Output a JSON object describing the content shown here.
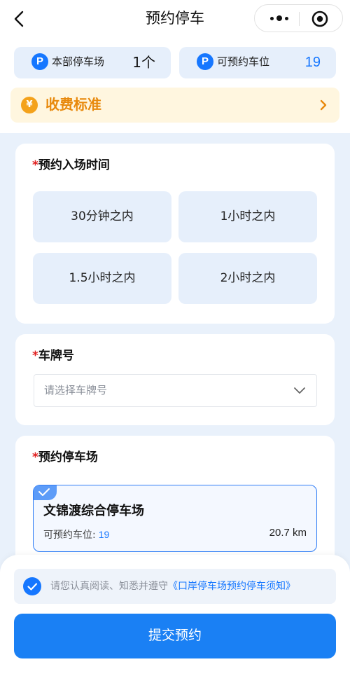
{
  "nav": {
    "title": "预约停车"
  },
  "stats": [
    {
      "icon": "P",
      "label": "本部停车场",
      "value": "1个"
    },
    {
      "icon": "P",
      "label": "可预约车位",
      "value": "19"
    }
  ],
  "fee": {
    "icon": "¥",
    "label": "收费标准"
  },
  "time_section": {
    "required_mark": "*",
    "title": "预约入场时间",
    "options": [
      "30分钟之内",
      "1小时之内",
      "1.5小时之内",
      "2小时之内"
    ]
  },
  "plate_section": {
    "required_mark": "*",
    "title": "车牌号",
    "placeholder": "请选择车牌号"
  },
  "lot_section": {
    "required_mark": "*",
    "title": "预约停车场",
    "selected_lot": {
      "name": "文锦渡综合停车场",
      "available_label": "可预约车位:",
      "available_value": "19",
      "distance": "20.7 km"
    }
  },
  "bottom": {
    "agreement_text": "请您认真阅读、知悉并遵守",
    "agreement_link": "《口岸停车场预约停车须知》",
    "submit_label": "提交预约"
  },
  "colors": {
    "accent": "#1677ff",
    "fee_orange": "#e8890c",
    "required": "#e02020"
  }
}
